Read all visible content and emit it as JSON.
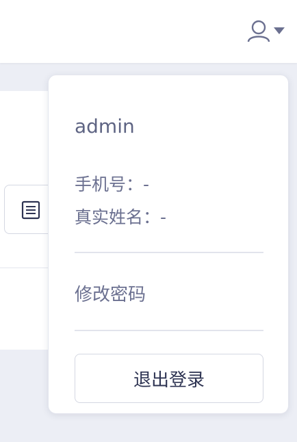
{
  "header": {
    "user_icon": "user-icon",
    "caret_icon": "caret-down-icon"
  },
  "background": {
    "doc_icon": "document-list-icon"
  },
  "user_menu": {
    "username": "admin",
    "phone": "手机号：-",
    "real_name": "真实姓名：-",
    "change_password": "修改密码",
    "logout": "退出登录"
  },
  "colors": {
    "page_bg": "#eceef5",
    "panel_bg": "#ffffff",
    "text_muted": "#6b7090",
    "text_dark": "#2d3352",
    "border": "#d4d7e2"
  }
}
